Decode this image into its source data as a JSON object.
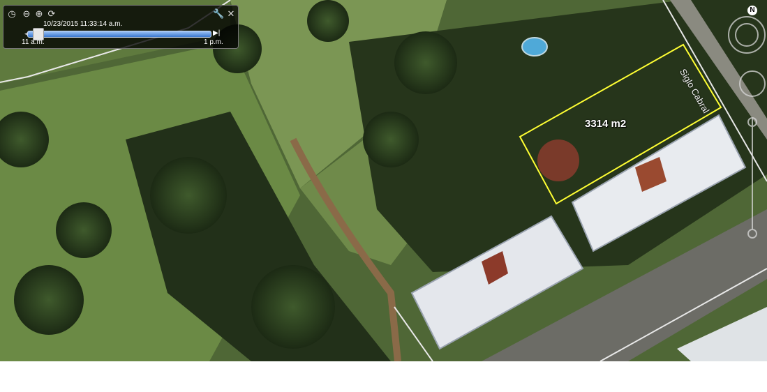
{
  "time_slider": {
    "datetime": "10/23/2015  11:33:14 a.m.",
    "start_label": "11 a.m.",
    "end_label": "1 p.m.",
    "position_fraction": 0.06
  },
  "map": {
    "area_label": "3314 m2",
    "street_label": "Siglo Cabral",
    "north_label": "N",
    "polygon_color": "#ffff33"
  }
}
